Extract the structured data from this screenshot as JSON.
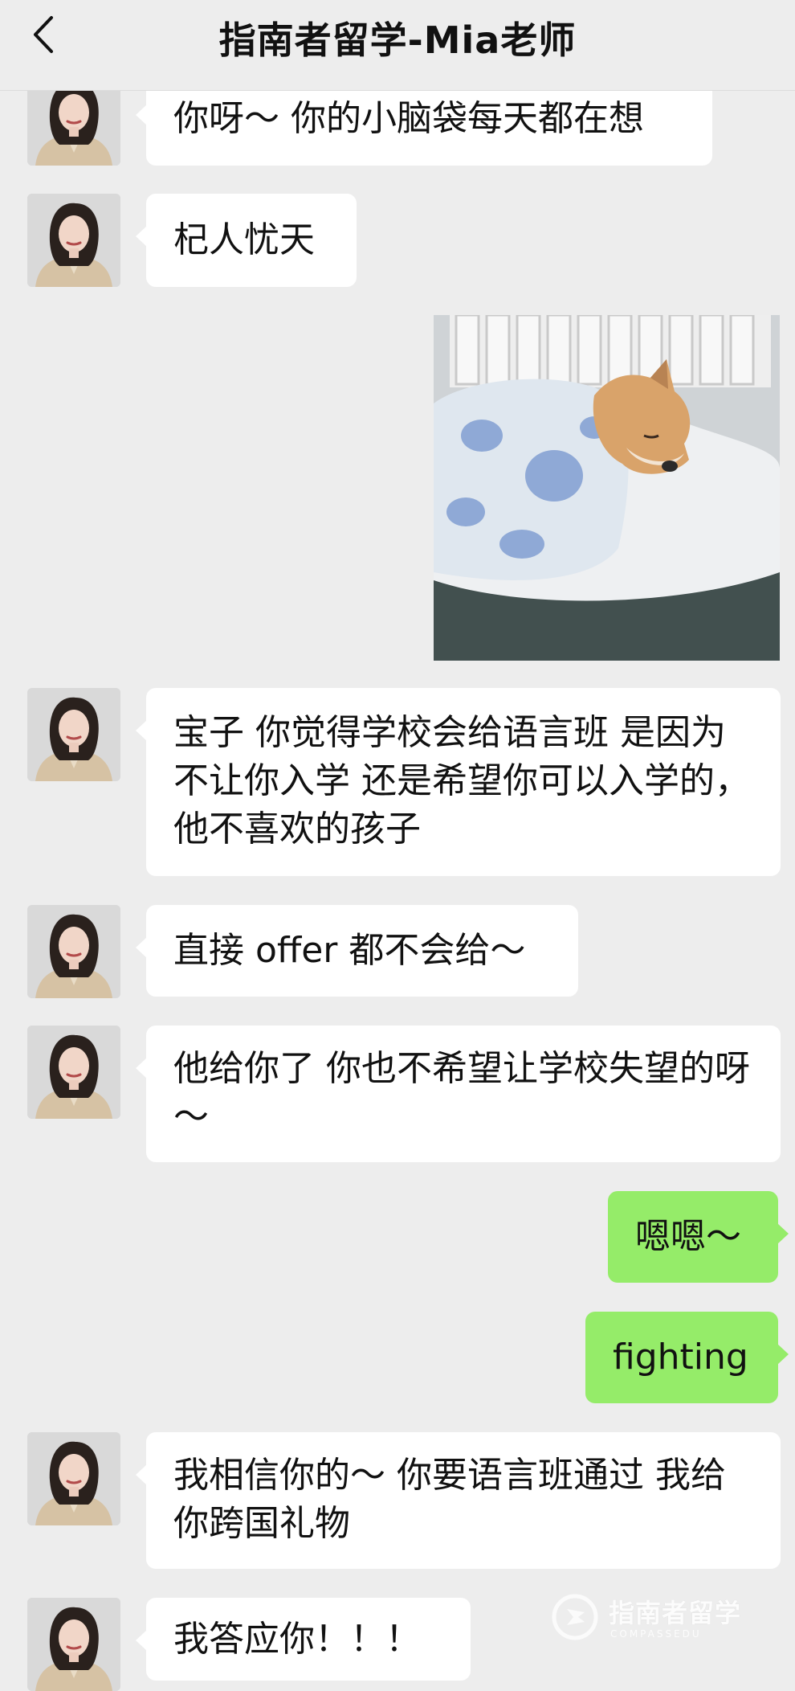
{
  "header": {
    "title": "指南者留学-Mia老师",
    "back_icon": "chevron-left-icon"
  },
  "messages": [
    {
      "side": "left",
      "text": "你呀～ 你的小脑袋每天都在想"
    },
    {
      "side": "left",
      "text": "杞人忧天"
    },
    {
      "side": "right",
      "type": "sticker",
      "icon": "sleeping-shiba-sticker"
    },
    {
      "side": "left",
      "text": "宝子 你觉得学校会给语言班 是因为不让你入学 还是希望你可以入学的，他不喜欢的孩子"
    },
    {
      "side": "left",
      "text": "直接 offer 都不会给～"
    },
    {
      "side": "left",
      "text": "他给你了 你也不希望让学校失望的呀～"
    },
    {
      "side": "right",
      "text": "嗯嗯～"
    },
    {
      "side": "right",
      "text": "fighting"
    },
    {
      "side": "left",
      "text": "我相信你的～ 你要语言班通过 我给你跨国礼物"
    },
    {
      "side": "left",
      "text": "我答应你！！！"
    }
  ],
  "watermark": {
    "text": "指南者留学",
    "sub": "COMPASSEDU"
  }
}
